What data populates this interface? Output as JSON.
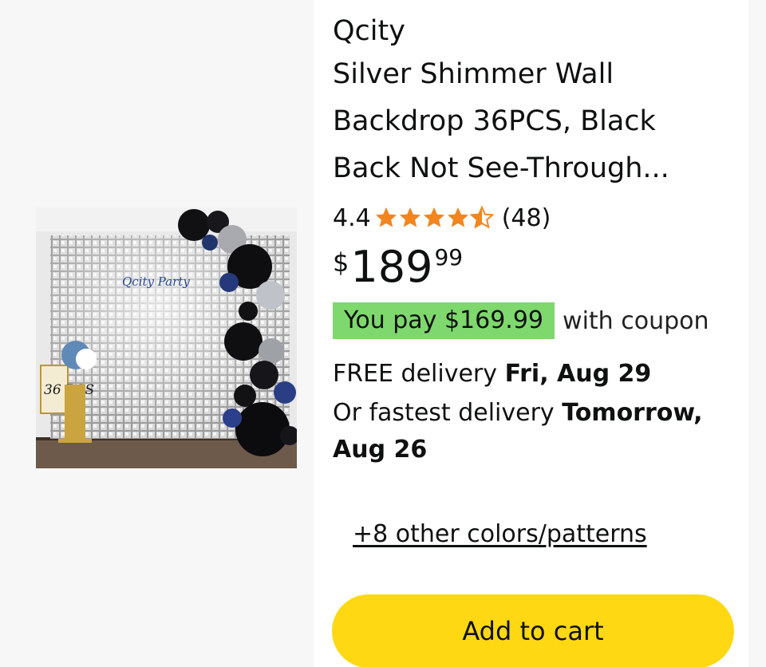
{
  "product": {
    "brand": "Qcity",
    "title": "Silver Shimmer Wall Backdrop 36PCS, Black Back Not See-Through...",
    "image_alt": "Silver shimmer wall backdrop with black and silver balloon garland",
    "image_text": "36 PCS",
    "rating": "4.4",
    "rating_value": 4.4,
    "rating_max": 5,
    "review_count": "(48)",
    "price": {
      "symbol": "$",
      "whole": "189",
      "fraction": "99"
    },
    "coupon": {
      "badge": "You pay $169.99",
      "suffix": "with coupon",
      "badge_color": "#7fd86d"
    },
    "delivery": {
      "prefix": "FREE delivery ",
      "date": "Fri, Aug 29"
    },
    "fastest": {
      "prefix": "Or fastest delivery ",
      "date": "Tomorrow, Aug 26"
    },
    "other_colors": "+8 other colors/patterns",
    "add_to_cart": "Add to cart"
  },
  "colors": {
    "star": "#f3851f",
    "cart_button": "#ffd814",
    "panel": "#f7f7f7"
  },
  "icons": {
    "star_full": "star-icon",
    "star_half": "star-half-icon"
  }
}
